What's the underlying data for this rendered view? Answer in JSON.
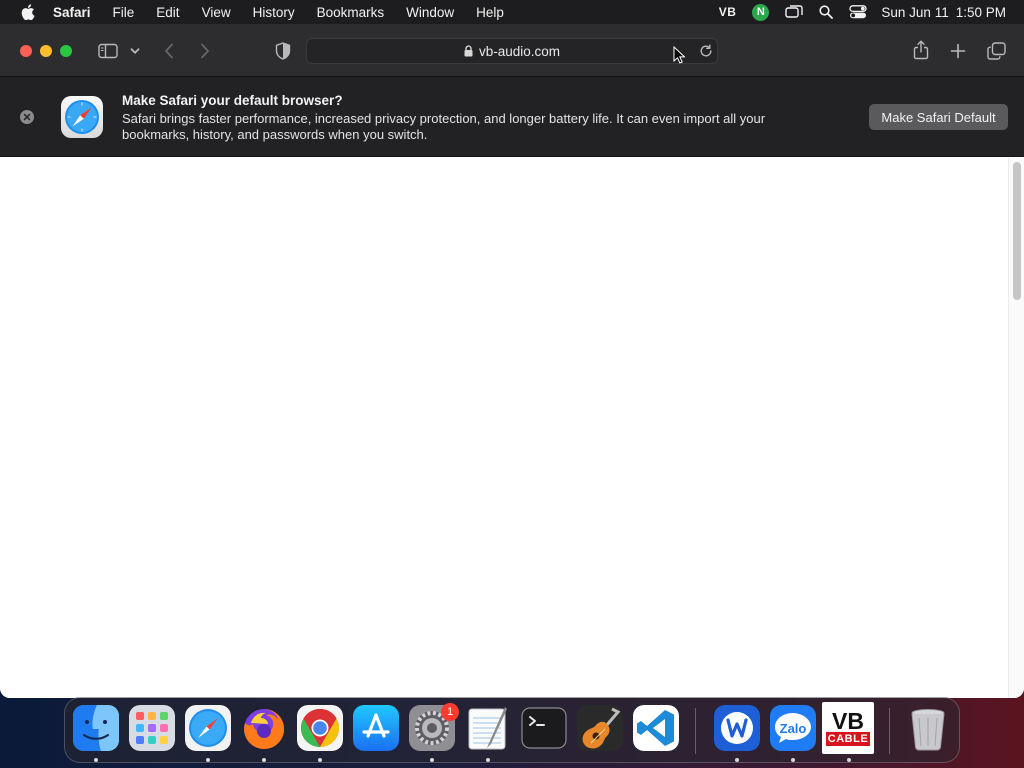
{
  "menubar": {
    "apple_icon": "apple-logo-icon",
    "app_name": "Safari",
    "items": [
      "File",
      "Edit",
      "View",
      "History",
      "Bookmarks",
      "Window",
      "Help"
    ],
    "status_vb": "VB",
    "status_n": "N",
    "clock_date": "Sun Jun 11",
    "clock_time": "1:50 PM"
  },
  "toolbar": {
    "url": "vb-audio.com"
  },
  "banner": {
    "title": "Make Safari your default browser?",
    "body": "Safari brings faster performance, increased privacy protection, and longer battery life. It can even import all your bookmarks, history, and passwords when you switch.",
    "button_label": "Make Safari Default"
  },
  "dock": {
    "apps": [
      "Finder",
      "Launchpad",
      "Safari",
      "Firefox",
      "Chrome",
      "App Store",
      "System Settings",
      "TextEdit",
      "Terminal",
      "GarageBand",
      "Visual Studio Code",
      "Word",
      "Zalo",
      "VB-Cable",
      "Trash"
    ],
    "settings_badge": "1",
    "zalo_label": "Zalo",
    "vb_label": "VB",
    "cable_label": "CABLE"
  },
  "colors": {
    "menubar_bg": "#1d1d1f",
    "toolbar_bg": "#2d2c2f",
    "banner_bg": "#222124",
    "close": "#fe5f57",
    "minimize": "#febc2e",
    "maximize": "#28c840",
    "badge": "#ff3b30"
  }
}
